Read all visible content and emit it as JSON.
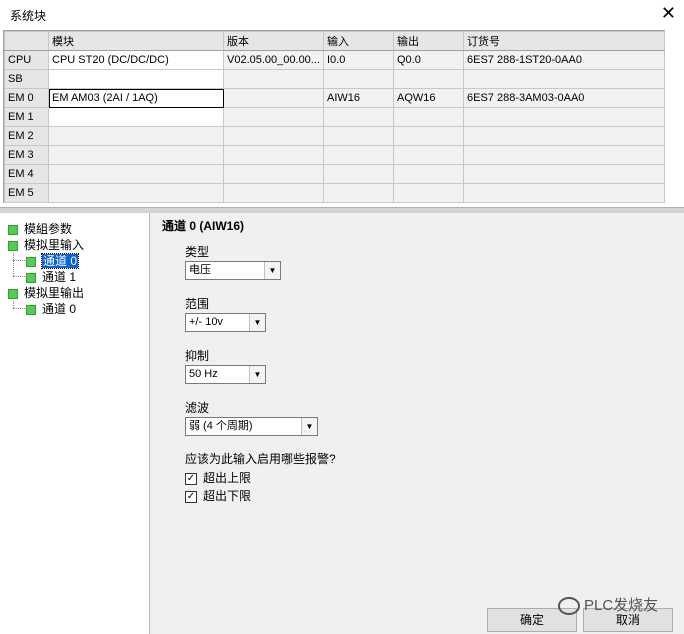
{
  "window": {
    "title": "系统块",
    "close_glyph": "✕"
  },
  "table": {
    "columns": [
      "模块",
      "版本",
      "输入",
      "输出",
      "订货号"
    ],
    "rows": [
      {
        "slot": "CPU",
        "module": "CPU ST20 (DC/DC/DC)",
        "version": "V02.05.00_00.00...",
        "input": "I0.0",
        "output": "Q0.0",
        "order": "6ES7 288-1ST20-0AA0"
      },
      {
        "slot": "SB",
        "module": "",
        "version": "",
        "input": "",
        "output": "",
        "order": ""
      },
      {
        "slot": "EM 0",
        "module": "EM AM03 (2AI / 1AQ)",
        "version": "",
        "input": "AIW16",
        "output": "AQW16",
        "order": "6ES7 288-3AM03-0AA0"
      },
      {
        "slot": "EM 1",
        "module": "",
        "version": "",
        "input": "",
        "output": "",
        "order": ""
      },
      {
        "slot": "EM 2",
        "module": "",
        "version": "",
        "input": "",
        "output": "",
        "order": ""
      },
      {
        "slot": "EM 3",
        "module": "",
        "version": "",
        "input": "",
        "output": "",
        "order": ""
      },
      {
        "slot": "EM 4",
        "module": "",
        "version": "",
        "input": "",
        "output": "",
        "order": ""
      },
      {
        "slot": "EM 5",
        "module": "",
        "version": "",
        "input": "",
        "output": "",
        "order": ""
      }
    ]
  },
  "tree": {
    "items": [
      {
        "label": "模組参数"
      },
      {
        "label": "模拟里输入"
      },
      {
        "label": "通道 0",
        "selected": true
      },
      {
        "label": "通道 1"
      },
      {
        "label": "模拟里输出"
      },
      {
        "label": "通道 0"
      }
    ]
  },
  "panel": {
    "heading": "通道 0 (AIW16)",
    "type": {
      "label": "类型",
      "value": "电压"
    },
    "range": {
      "label": "范围",
      "value": "+/- 10v"
    },
    "rejection": {
      "label": "抑制",
      "value": "50 Hz"
    },
    "filter": {
      "label": "滤波",
      "value": "弱 (4 个周期)"
    },
    "alarm_question": "应该为此输入启用哪些报警?",
    "alarms": [
      {
        "label": "超出上限",
        "checked": true,
        "mark": "✓"
      },
      {
        "label": "超出下限",
        "checked": true,
        "mark": "✓"
      }
    ],
    "ok_label": "确定",
    "cancel_label": "取消"
  },
  "watermark": {
    "text": "PLC发烧友"
  }
}
